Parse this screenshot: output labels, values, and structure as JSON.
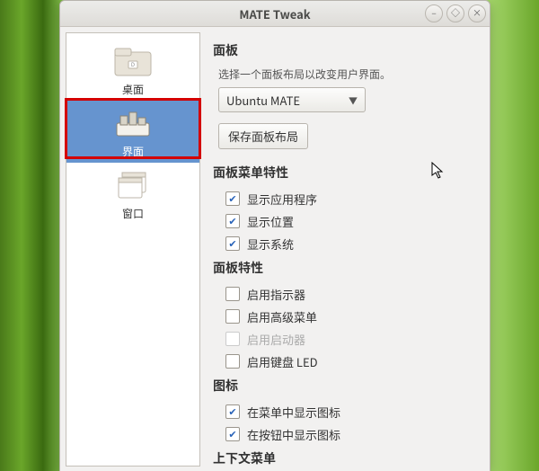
{
  "window": {
    "title": "MATE Tweak"
  },
  "sidebar": {
    "items": [
      {
        "label": "桌面"
      },
      {
        "label": "界面"
      },
      {
        "label": "窗口"
      }
    ],
    "selected_index": 1
  },
  "panel": {
    "heading": "面板",
    "description": "选择一个面板布局以改变用户界面。",
    "layout_selected": "Ubuntu MATE",
    "save_button": "保存面板布局"
  },
  "panel_menu_features": {
    "heading": "面板菜单特性",
    "items": [
      {
        "label": "显示应用程序",
        "checked": true
      },
      {
        "label": "显示位置",
        "checked": true
      },
      {
        "label": "显示系统",
        "checked": true
      }
    ]
  },
  "panel_features": {
    "heading": "面板特性",
    "items": [
      {
        "label": "启用指示器",
        "checked": false,
        "disabled": false
      },
      {
        "label": "启用高级菜单",
        "checked": false,
        "disabled": false
      },
      {
        "label": "启用启动器",
        "checked": false,
        "disabled": true
      },
      {
        "label": "启用键盘 LED",
        "checked": false,
        "disabled": false
      }
    ]
  },
  "icons": {
    "heading": "图标",
    "items": [
      {
        "label": "在菜单中显示图标",
        "checked": true
      },
      {
        "label": "在按钮中显示图标",
        "checked": true
      }
    ]
  },
  "context_menu": {
    "heading": "上下文菜单"
  }
}
